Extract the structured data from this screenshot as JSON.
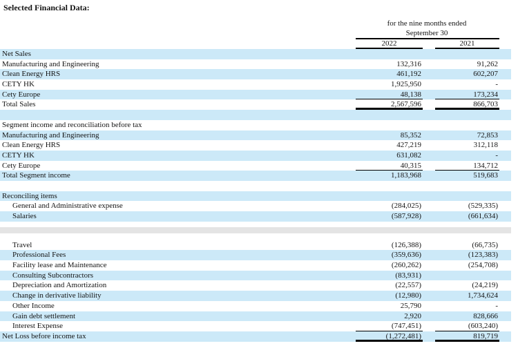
{
  "title": "Selected Financial Data:",
  "colors": {
    "stripe_blue": "#cce9f8",
    "divider_gray": "#e4e4e4",
    "rule_black": "#000000"
  },
  "table": {
    "period": {
      "line1": "for the nine months ended",
      "line2": "September 30"
    },
    "columns": [
      "2022",
      "2021"
    ],
    "rows": [
      {
        "label": "Net Sales",
        "shade": "blue",
        "v2022": "",
        "v2021": ""
      },
      {
        "label": "Manufacturing and Engineering",
        "v2022": "132,316",
        "v2021": "91,262"
      },
      {
        "label": "Clean Energy HRS",
        "shade": "blue",
        "v2022": "461,192",
        "v2021": "602,207"
      },
      {
        "label": "CETY HK",
        "v2022": "1,925,950",
        "v2021": "-"
      },
      {
        "label": "Cety Europe",
        "shade": "blue",
        "v2022": "48,138",
        "v2021": "173,234",
        "rule": "single"
      },
      {
        "label": "Total Sales",
        "v2022": "2,567,596",
        "v2021": "866,703",
        "rule": "thick"
      },
      {
        "label": "",
        "shade": "blue",
        "v2022": "",
        "v2021": ""
      },
      {
        "label": "Segment income and reconciliation before tax",
        "v2022": "",
        "v2021": ""
      },
      {
        "label": "Manufacturing and Engineering",
        "shade": "blue",
        "v2022": "85,352",
        "v2021": "72,853"
      },
      {
        "label": "Clean Energy HRS",
        "v2022": "427,219",
        "v2021": "312,118"
      },
      {
        "label": "CETY HK",
        "shade": "blue",
        "v2022": "631,082",
        "v2021": "-"
      },
      {
        "label": "Cety Europe",
        "v2022": "40,315",
        "v2021": "134,712",
        "rule": "single"
      },
      {
        "label": "Total Segment income",
        "shade": "blue",
        "v2022": "1,183,968",
        "v2021": "519,683"
      },
      {
        "label": "",
        "v2022": "",
        "v2021": ""
      },
      {
        "label": "Reconciling items",
        "shade": "blue",
        "v2022": "",
        "v2021": ""
      },
      {
        "label": "General and Administrative expense",
        "indent": true,
        "v2022": "(284,025)",
        "v2021": "(529,335)"
      },
      {
        "label": "Salaries",
        "shade": "blue",
        "indent": true,
        "v2022": "(587,928)",
        "v2021": "(661,634)"
      },
      {
        "label": "",
        "v2022": "",
        "v2021": "",
        "height": 8
      },
      {
        "label": "",
        "shade": "gray",
        "v2022": "",
        "v2021": "",
        "height": 9
      },
      {
        "label": "",
        "v2022": "",
        "v2021": "",
        "height": 10
      },
      {
        "label": "Travel",
        "indent": true,
        "v2022": "(126,388)",
        "v2021": "(66,735)"
      },
      {
        "label": "Professional Fees",
        "shade": "blue",
        "indent": true,
        "v2022": "(359,636)",
        "v2021": "(123,383)"
      },
      {
        "label": "Facility lease and Maintenance",
        "indent": true,
        "v2022": "(260,262)",
        "v2021": "(254,708)"
      },
      {
        "label": "Consulting Subcontractors",
        "shade": "blue",
        "indent": true,
        "v2022": "(83,931)",
        "v2021": ""
      },
      {
        "label": "Depreciation and Amortization",
        "indent": true,
        "v2022": "(22,557)",
        "v2021": "(24,219)"
      },
      {
        "label": "Change in derivative liability",
        "shade": "blue",
        "indent": true,
        "v2022": "(12,980)",
        "v2021": "1,734,624"
      },
      {
        "label": "Other Income",
        "indent": true,
        "v2022": "25,790",
        "v2021": "-"
      },
      {
        "label": "Gain debt settlement",
        "shade": "blue",
        "indent": true,
        "v2022": "2,920",
        "v2021": "828,666"
      },
      {
        "label": "Interest Expense",
        "indent": true,
        "v2022": "(747,451)",
        "v2021": "(603,240)",
        "rule": "single"
      },
      {
        "label": "Net Loss before income tax",
        "shade": "blue",
        "v2022": "(1,272,481)",
        "v2021": "819,719",
        "rule": "thick"
      }
    ]
  }
}
